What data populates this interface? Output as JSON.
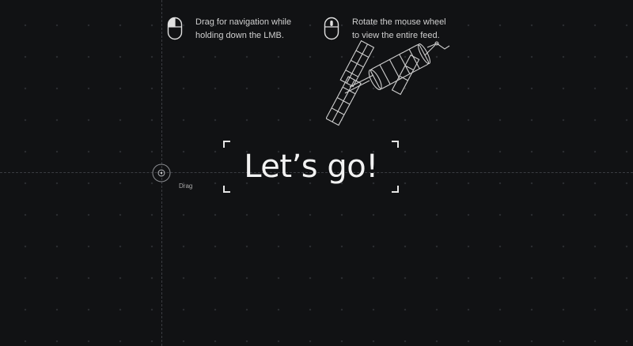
{
  "hints": {
    "drag": {
      "icon": "mouse-left-button-icon",
      "line1": "Drag for navigation while",
      "line2": "holding down the LMB."
    },
    "wheel": {
      "icon": "mouse-wheel-icon",
      "line1": "Rotate the mouse wheel",
      "line2": "to view the entire feed."
    }
  },
  "main": {
    "title": "Let’s go!"
  },
  "cursor": {
    "label": "Drag",
    "icon": "drag-target-icon"
  },
  "decoration": {
    "icon": "satellite-icon"
  },
  "colors": {
    "background": "#111214",
    "text": "#f2f2f2",
    "grid_dot": "#2b2d31",
    "guide_line": "#3a3c41"
  }
}
